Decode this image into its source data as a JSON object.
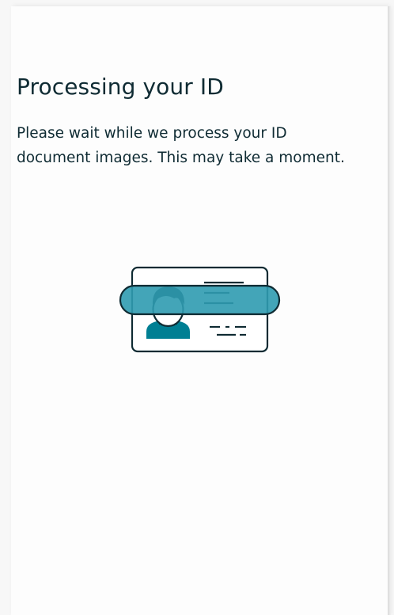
{
  "screen": {
    "title": "Processing your ID",
    "description": "Please wait while we process your ID document images. This may take a moment."
  },
  "illustration": {
    "icon": "id-card-scan-icon",
    "colors": {
      "outline": "#0f2b33",
      "scan_bar": "#2f9bb0",
      "accent": "#007f93"
    }
  }
}
